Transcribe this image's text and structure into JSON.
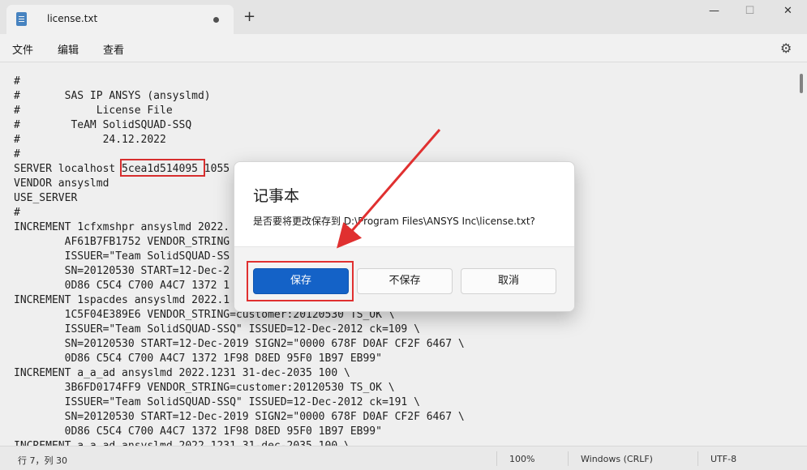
{
  "tab": {
    "title": "license.txt",
    "new_tab_label": "+"
  },
  "window_controls": {
    "minimize": "—",
    "maximize": "☐",
    "close": "✕"
  },
  "menu": {
    "file": "文件",
    "edit": "编辑",
    "view": "查看",
    "settings_icon": "⚙"
  },
  "editor": {
    "lines": [
      "#",
      "#       SAS IP ANSYS (ansyslmd)",
      "#            License File",
      "#        TeAM SolidSQUAD-SSQ",
      "#             24.12.2022",
      "#",
      "SERVER localhost 5cea1d514095 1055",
      "VENDOR ansyslmd",
      "USE_SERVER",
      "#",
      "INCREMENT 1cfxmshpr ansyslmd 2022.",
      "        AF61B7FB1752 VENDOR_STRING",
      "        ISSUER=\"Team SolidSQUAD-SS",
      "        SN=20120530 START=12-Dec-2",
      "        0D86 C5C4 C700 A4C7 1372 1",
      "INCREMENT 1spacdes ansyslmd 2022.1",
      "        1C5F04E389E6 VENDOR_STRING=customer:20120530 TS_OK \\",
      "        ISSUER=\"Team SolidSQUAD-SSQ\" ISSUED=12-Dec-2012 ck=109 \\",
      "        SN=20120530 START=12-Dec-2019 SIGN2=\"0000 678F D0AF CF2F 6467 \\",
      "        0D86 C5C4 C700 A4C7 1372 1F98 D8ED 95F0 1B97 EB99\"",
      "INCREMENT a_a_ad ansyslmd 2022.1231 31-dec-2035 100 \\",
      "        3B6FD0174FF9 VENDOR_STRING=customer:20120530 TS_OK \\",
      "        ISSUER=\"Team SolidSQUAD-SSQ\" ISSUED=12-Dec-2012 ck=191 \\",
      "        SN=20120530 START=12-Dec-2019 SIGN2=\"0000 678F D0AF CF2F 6467 \\",
      "        0D86 C5C4 C700 A4C7 1372 1F98 D8ED 95F0 1B97 EB99\"",
      "INCREMENT a_a_ad ansyslmd 2022.1231 31-dec-2035 100 \\"
    ]
  },
  "statusbar": {
    "position": "行 7，列 30",
    "zoom": "100%",
    "line_ending": "Windows (CRLF)",
    "encoding": "UTF-8"
  },
  "dialog": {
    "title": "记事本",
    "message": "是否要将更改保存到 D:\\Program Files\\ANSYS Inc\\license.txt?",
    "save_label": "保存",
    "dont_save_label": "不保存",
    "cancel_label": "取消"
  },
  "annotation_color": "#e03030"
}
